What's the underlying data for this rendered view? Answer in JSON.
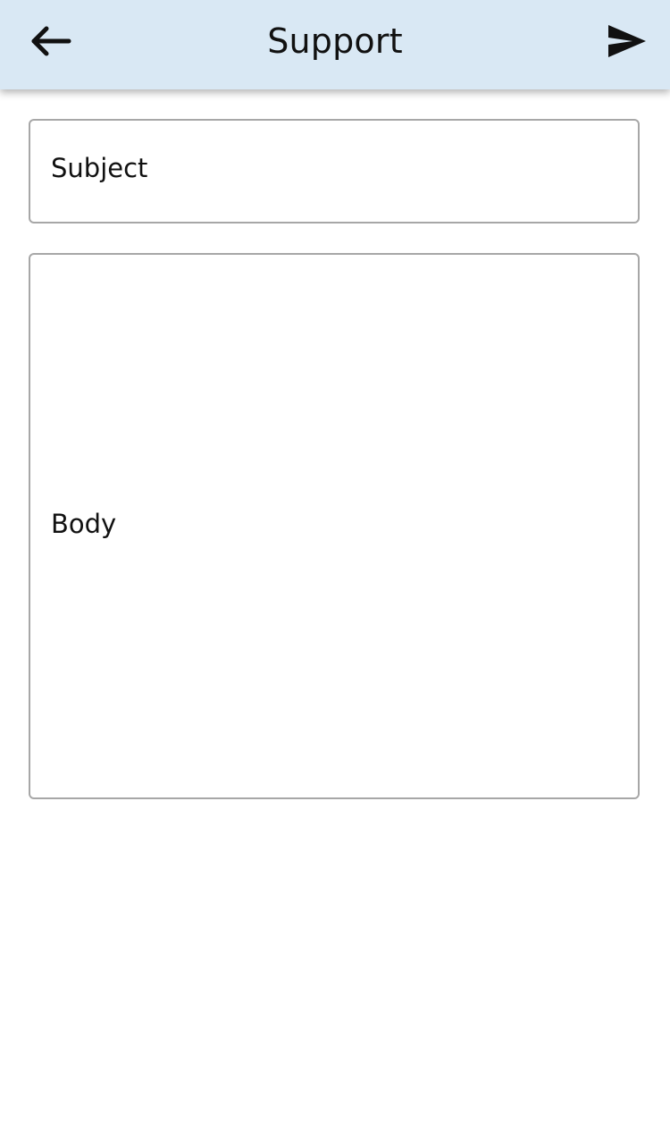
{
  "header": {
    "title": "Support",
    "back_icon": "arrow-left-icon",
    "send_icon": "send-icon"
  },
  "form": {
    "subject_placeholder": "Subject",
    "body_placeholder": "Body"
  },
  "colors": {
    "header_background": "#d9e8f4",
    "field_border": "#a7a7a7",
    "text": "#111111"
  }
}
